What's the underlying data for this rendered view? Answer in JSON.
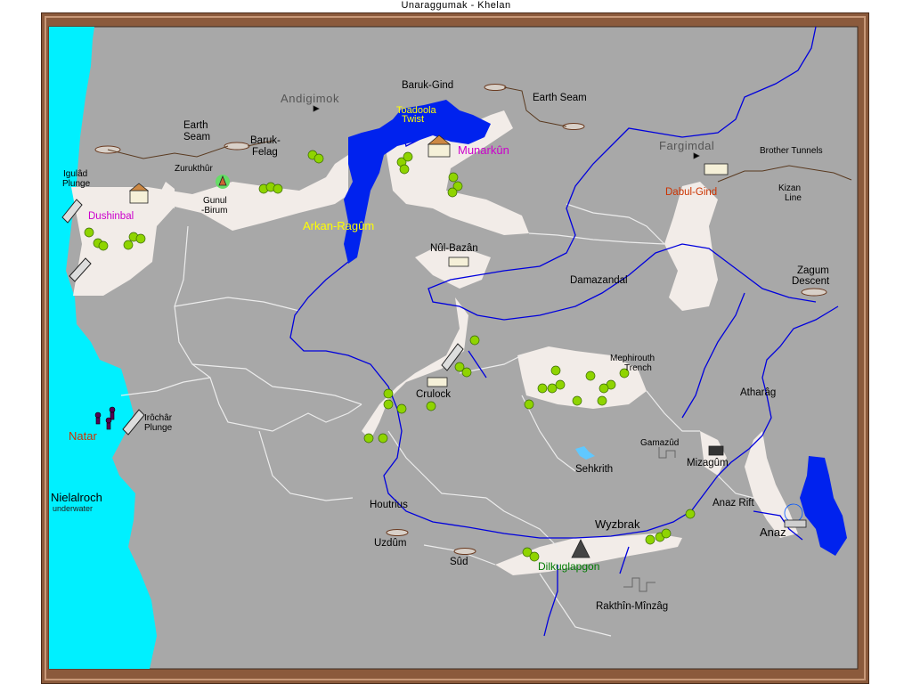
{
  "title": "Unaraggumak - Khelan",
  "colors": {
    "frame": "#8b5a3c",
    "land": "#a8a8a8",
    "sea": "#00f0ff",
    "lake": "#0022ee",
    "river": "#0000dd",
    "road": "#f2ece8",
    "tree": "#8fd400",
    "kingdom": "#cc00cc",
    "city_red": "#cc3300",
    "city_green": "#007a00",
    "city_yellow": "#ffff00"
  },
  "places": {
    "andigimok": "Andigimok",
    "baruk_gind": "Baruk-Gind",
    "earth_seam_ne": "Earth Seam",
    "toadoola_twist_1": "Toadoola",
    "toadoola_twist_2": "Twist",
    "earth_seam_nw_1": "Earth",
    "earth_seam_nw_2": "Seam",
    "baruk_felag_1": "Baruk-",
    "baruk_felag_2": "Felag",
    "zurukthur": "Zurukthûr",
    "gunul_birum_1": "Gunul",
    "gunul_birum_2": "-Birum",
    "igulad_plunge_1": "Igulâd",
    "igulad_plunge_2": "Plunge",
    "dushinbal": "Dushinbal",
    "munarkun": "Munarkûn",
    "arkan_ragum": "Arkan-Ragûm",
    "fargimdal": "Fargimdal",
    "brother_tunnels": "Brother Tunnels",
    "dabul_gind": "Dabul-Gind",
    "kizan_line_1": "Kizan",
    "kizan_line_2": "Line",
    "nul_bazan": "Nûl-Bazân",
    "damazandal": "Damazandal",
    "zagum_descent_1": "Zagum",
    "zagum_descent_2": "Descent",
    "mephirouth_1": "Mephirouth",
    "mephirouth_2": "Trench",
    "crulock": "Crulock",
    "atharag": "Atharâg",
    "irochar_1": "Irôchâr",
    "irochar_2": "Plunge",
    "natar": "Natar",
    "gamazud": "Gamazûd",
    "mizagum": "Mizagûm",
    "sehkrith": "Sehkrith",
    "nielalroch": "Nielalroch",
    "underwater": "underwater",
    "houtrius": "Houtrius",
    "anaz_rift": "Anaz Rift",
    "wyzbrak": "Wyzbrak",
    "anaz": "Anaz",
    "uzdum": "Uzdûm",
    "sud": "Sûd",
    "dilkuglapgon": "Dilkuglapgon",
    "rakthin_minzag": "Rakthîn-Mînzâg"
  }
}
